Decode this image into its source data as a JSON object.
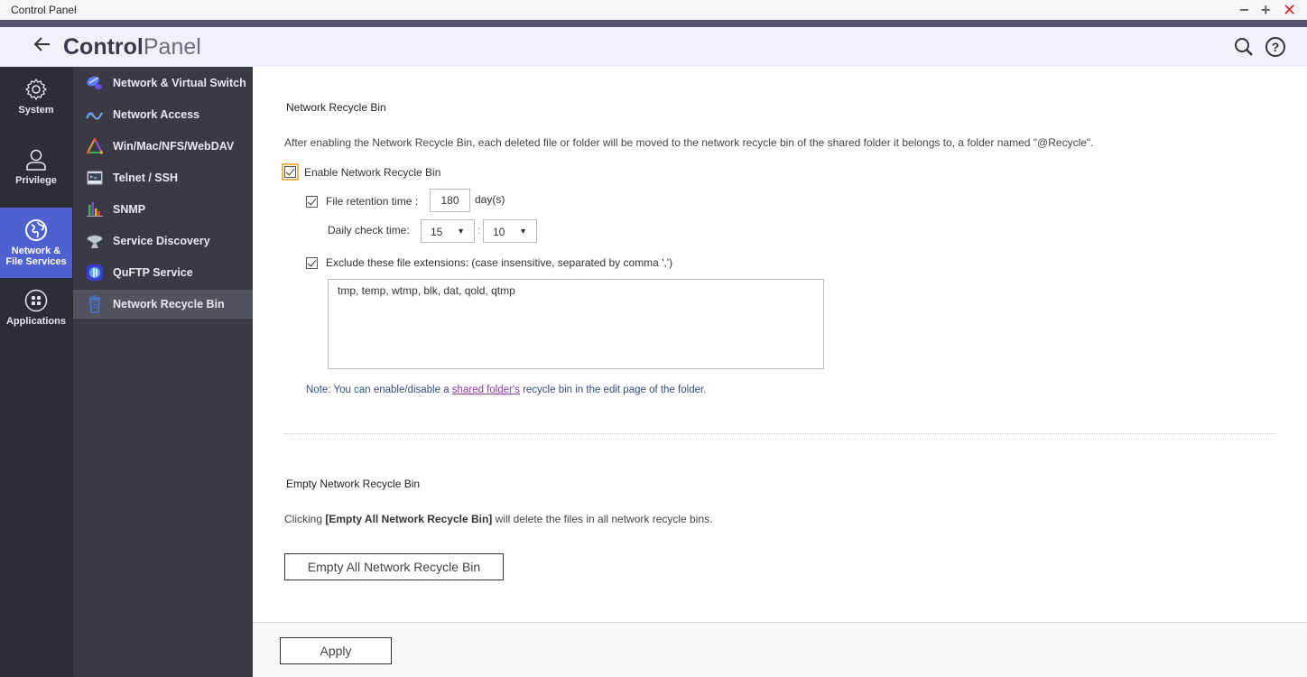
{
  "window": {
    "title": "Control Panel",
    "controls": {
      "minimize": "−",
      "maximize": "+",
      "close": "✕"
    }
  },
  "header": {
    "back_icon": "←",
    "title_bold": "Control",
    "title_light": "Panel"
  },
  "rail": {
    "items": [
      {
        "label": "System",
        "icon": "gear-icon"
      },
      {
        "label": "Privilege",
        "icon": "user-icon"
      },
      {
        "label": "Network & File Services",
        "icon": "globe-icon",
        "active": true
      },
      {
        "label": "Applications",
        "icon": "grid-icon"
      }
    ]
  },
  "subnav": {
    "items": [
      {
        "label": "Network & Virtual Switch",
        "icon": "network-switch-icon"
      },
      {
        "label": "Network Access",
        "icon": "network-access-icon"
      },
      {
        "label": "Win/Mac/NFS/WebDAV",
        "icon": "triangle-protocol-icon"
      },
      {
        "label": "Telnet / SSH",
        "icon": "terminal-icon"
      },
      {
        "label": "SNMP",
        "icon": "bar-chart-icon"
      },
      {
        "label": "Service Discovery",
        "icon": "satellite-dish-icon"
      },
      {
        "label": "QuFTP Service",
        "icon": "quftp-icon"
      },
      {
        "label": "Network Recycle Bin",
        "icon": "recycle-bin-icon",
        "active": true
      }
    ]
  },
  "recycle_bin": {
    "title": "Network Recycle Bin",
    "description": "After enabling the Network Recycle Bin, each deleted file or folder will be moved to the network recycle bin of the shared folder it belongs to, a folder named \"@Recycle\".",
    "enable_label": "Enable Network Recycle Bin",
    "enable_checked": true,
    "retention_label": "File retention time :",
    "retention_checked": true,
    "retention_value": "180",
    "retention_unit": "day(s)",
    "check_time_label": "Daily check time:",
    "check_hour": "15",
    "check_minute": "10",
    "time_separator": ":",
    "exclude_label": "Exclude these file extensions: (case insensitive, separated by comma ',')",
    "exclude_checked": true,
    "exclude_value": "tmp, temp, wtmp, blk, dat, qold, qtmp",
    "note_prefix": "Note:",
    "note_text_before": " You can enable/disable a ",
    "note_link": "shared folder's",
    "note_text_after": " recycle bin in the edit page of the folder."
  },
  "empty_bin": {
    "title": "Empty Network Recycle Bin",
    "desc_before": "Clicking ",
    "desc_bold": "[Empty All Network Recycle Bin]",
    "desc_after": " will delete the files in all network recycle bins.",
    "button_label": "Empty All Network Recycle Bin"
  },
  "footer": {
    "apply_label": "Apply"
  }
}
